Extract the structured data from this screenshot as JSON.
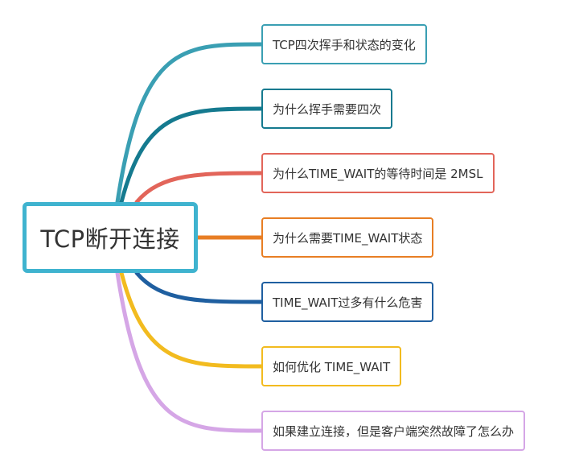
{
  "root": {
    "label": "TCP断开连接",
    "color": "#3fb3cf"
  },
  "branches": [
    {
      "label": "TCP四次挥手和状态的变化",
      "color": "#3a9fb3"
    },
    {
      "label": "为什么挥手需要四次",
      "color": "#157a8f"
    },
    {
      "label": "为什么TIME_WAIT的等待时间是 2MSL",
      "color": "#e2655a"
    },
    {
      "label": "为什么需要TIME_WAIT状态",
      "color": "#e87e24"
    },
    {
      "label": "TIME_WAIT过多有什么危害",
      "color": "#1f5fa0"
    },
    {
      "label": "如何优化 TIME_WAIT",
      "color": "#f2bb1f"
    },
    {
      "label": "如果建立连接，但是客户端突然故障了怎么办",
      "color": "#d5a6e6"
    }
  ]
}
